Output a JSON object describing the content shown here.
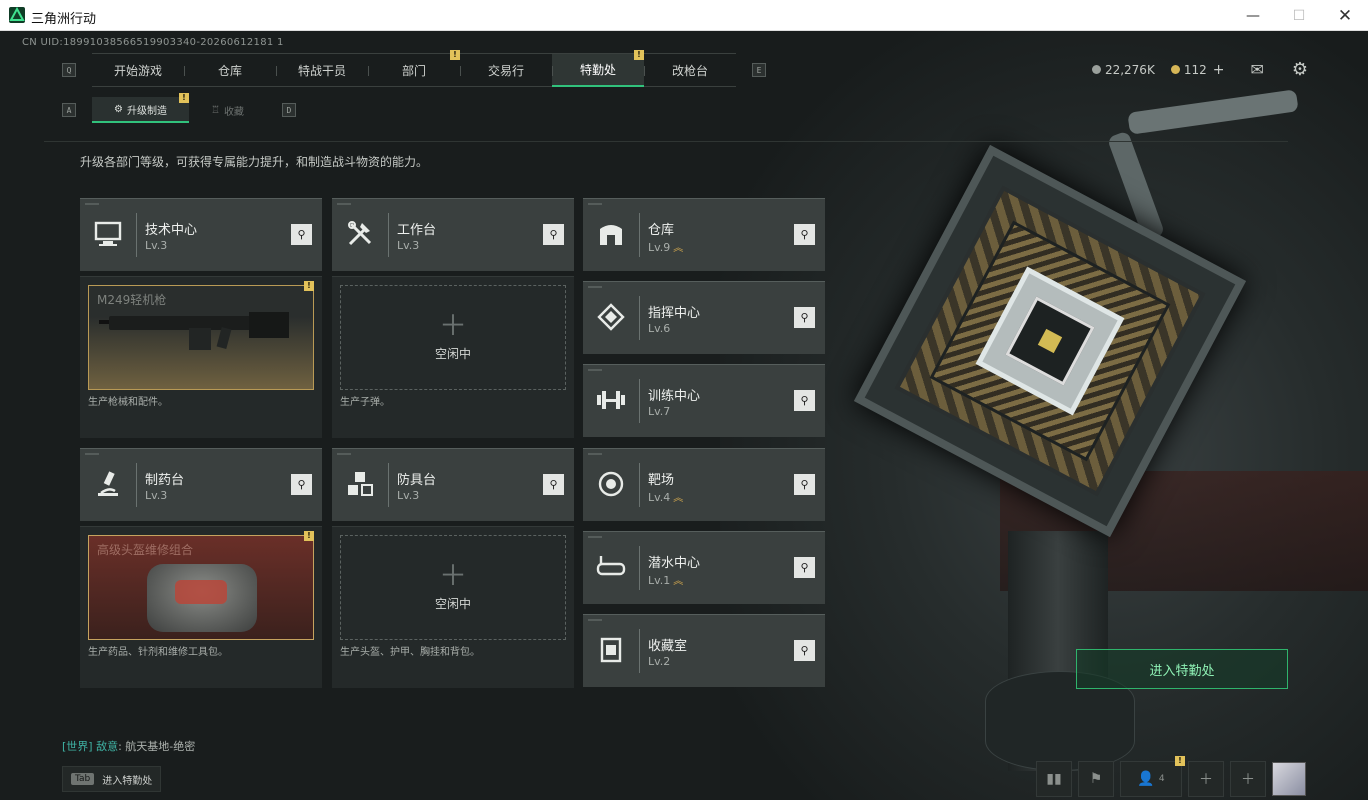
{
  "window": {
    "title": "三角洲行动"
  },
  "top_info": "CN UID:18991038566519903340-20260612181 1",
  "nav": {
    "left_key": "Q",
    "right_key": "E",
    "tabs": [
      {
        "label": "开始游戏",
        "badge": ""
      },
      {
        "label": "仓库",
        "badge": ""
      },
      {
        "label": "特战干员",
        "badge": ""
      },
      {
        "label": "部门",
        "badge": "!"
      },
      {
        "label": "交易行",
        "badge": ""
      },
      {
        "label": "特勤处",
        "badge": "!",
        "active": true
      },
      {
        "label": "改枪台",
        "badge": ""
      }
    ]
  },
  "subnav": {
    "left_key": "A",
    "right_key": "D",
    "tabs": [
      {
        "label": "升级制造",
        "badge": "!",
        "active": true
      },
      {
        "label": "收藏",
        "badge": ""
      }
    ]
  },
  "currency": {
    "silver": "22,276K",
    "gold": "112",
    "add": "+"
  },
  "description": "升级各部门等级，可获得专属能力提升，和制造战斗物资的能力。",
  "facilities": {
    "tech": {
      "name": "技术中心",
      "level": "Lv.3"
    },
    "workbench": {
      "name": "工作台",
      "level": "Lv.3"
    },
    "warehouse": {
      "name": "仓库",
      "level": "Lv.9"
    },
    "command": {
      "name": "指挥中心",
      "level": "Lv.6"
    },
    "training": {
      "name": "训练中心",
      "level": "Lv.7"
    },
    "pharma": {
      "name": "制药台",
      "level": "Lv.3"
    },
    "armor": {
      "name": "防具台",
      "level": "Lv.3"
    },
    "range": {
      "name": "靶场",
      "level": "Lv.4"
    },
    "diving": {
      "name": "潜水中心",
      "level": "Lv.1"
    },
    "collection": {
      "name": "收藏室",
      "level": "Lv.2"
    }
  },
  "production": {
    "tech": {
      "item": "M249轻机枪",
      "text": "生产枪械和配件。",
      "badge": "!"
    },
    "workbench": {
      "idle": "空闲中",
      "text": "生产子弹。"
    },
    "pharma": {
      "item": "高级头盔维修组合",
      "text": "生产药品、针剂和维修工具包。",
      "badge": "!"
    },
    "armor": {
      "idle": "空闲中",
      "text": "生产头盔、护甲、胸挂和背包。"
    }
  },
  "enter_button": "进入特勤处",
  "chat": {
    "channel": "[世界]",
    "user": "敌意",
    "message": ": 航天基地-绝密"
  },
  "tab_hint": {
    "key": "Tab",
    "label": "进入特勤处"
  },
  "bottom": {
    "friends_count": "4",
    "badge": "!"
  },
  "colors": {
    "accent": "#31c27c",
    "badge": "#e2c25a",
    "upgrade": "#d0a64e"
  }
}
